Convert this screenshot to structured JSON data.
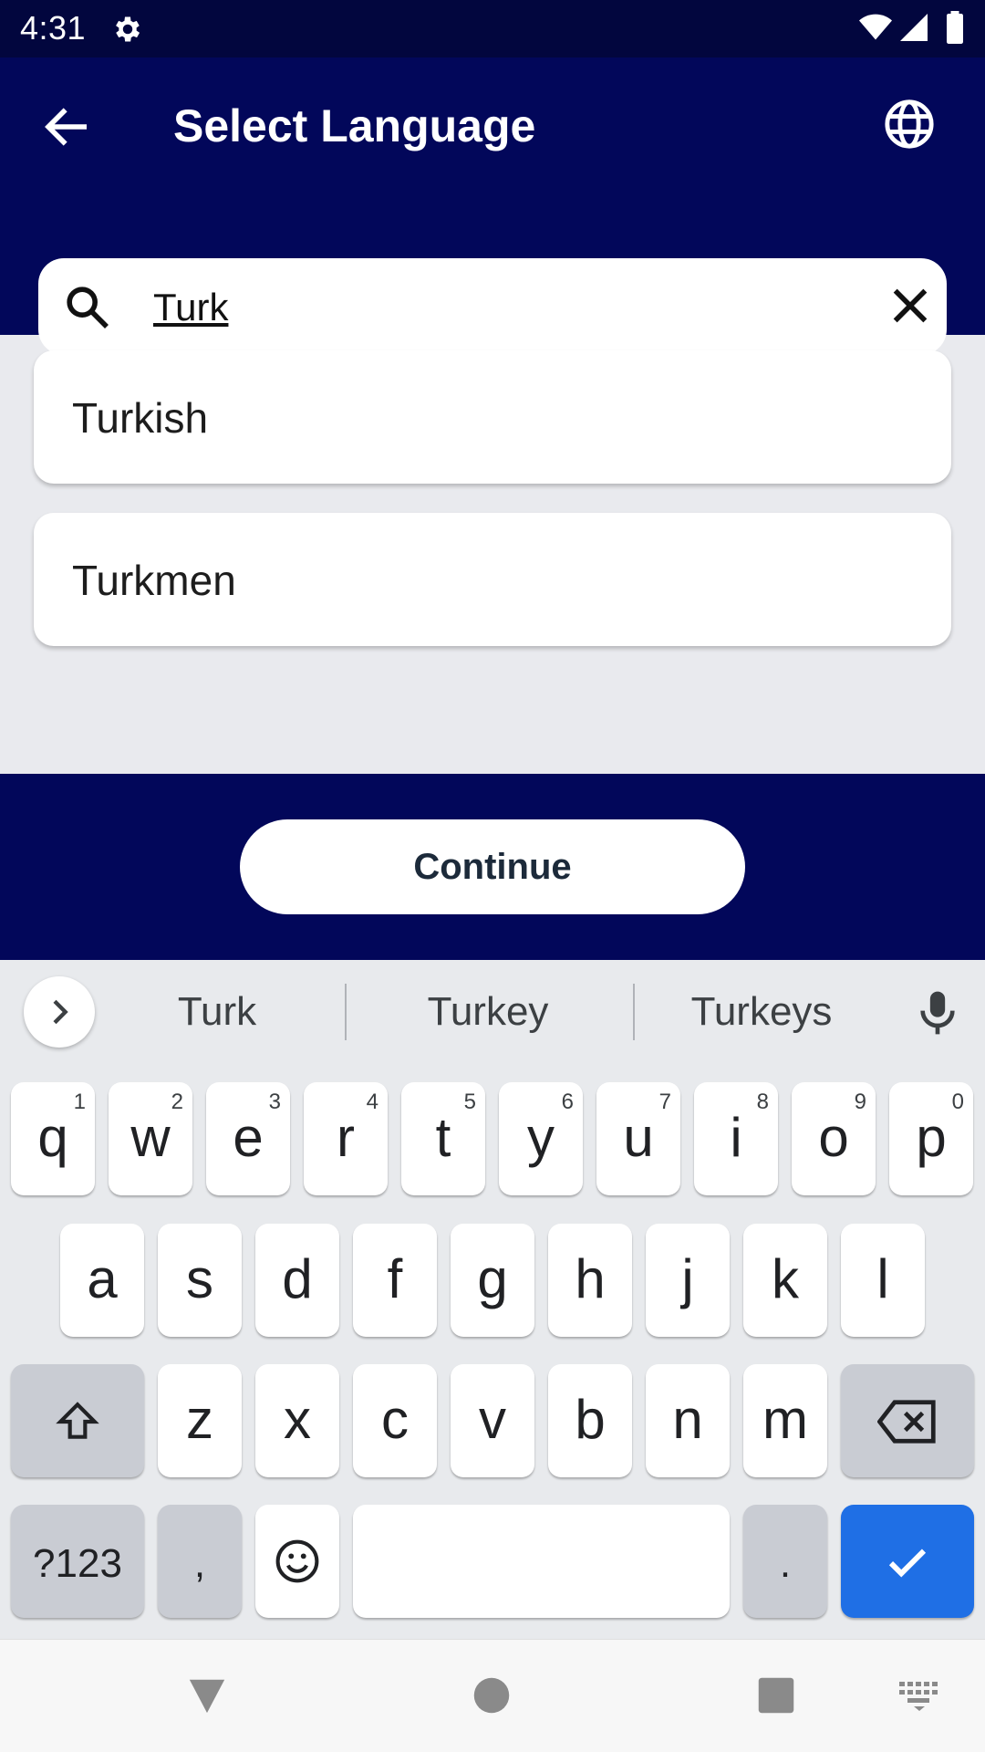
{
  "status_bar": {
    "time": "4:31",
    "icons": [
      "gear-icon",
      "wifi-icon",
      "signal-icon",
      "battery-icon"
    ]
  },
  "app_bar": {
    "title": "Select Language",
    "back_icon": "arrow-left-icon",
    "language_icon": "globe-icon"
  },
  "search": {
    "value": "Turk",
    "search_icon": "search-icon",
    "clear_icon": "close-icon"
  },
  "results": [
    {
      "label": "Turkish"
    },
    {
      "label": "Turkmen"
    }
  ],
  "continue_label": "Continue",
  "keyboard": {
    "suggestions": [
      "Turk",
      "Turkey",
      "Turkeys"
    ],
    "row1": [
      {
        "key": "q",
        "hint": "1"
      },
      {
        "key": "w",
        "hint": "2"
      },
      {
        "key": "e",
        "hint": "3"
      },
      {
        "key": "r",
        "hint": "4"
      },
      {
        "key": "t",
        "hint": "5"
      },
      {
        "key": "y",
        "hint": "6"
      },
      {
        "key": "u",
        "hint": "7"
      },
      {
        "key": "i",
        "hint": "8"
      },
      {
        "key": "o",
        "hint": "9"
      },
      {
        "key": "p",
        "hint": "0"
      }
    ],
    "row2": [
      "a",
      "s",
      "d",
      "f",
      "g",
      "h",
      "j",
      "k",
      "l"
    ],
    "row3": [
      "z",
      "x",
      "c",
      "v",
      "b",
      "n",
      "m"
    ],
    "symbols_label": "?123",
    "comma_label": ",",
    "period_label": ".",
    "accent_color": "#1f6fe5"
  },
  "colors": {
    "header": "#02075a",
    "status_bar": "#02063e",
    "background": "#e9eaee"
  }
}
